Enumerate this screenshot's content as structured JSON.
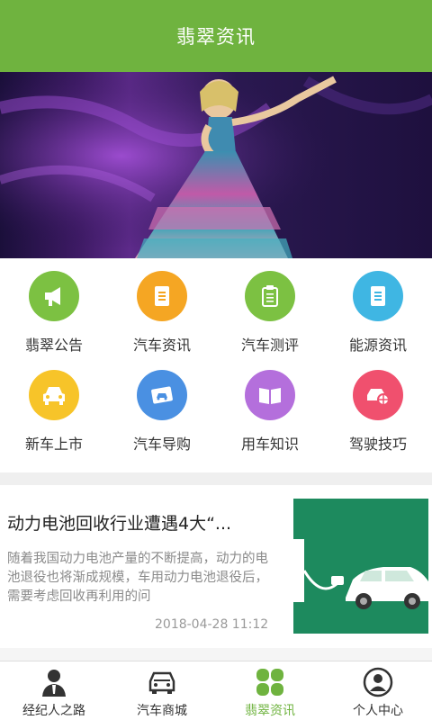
{
  "header": {
    "title": "翡翠资讯"
  },
  "colors": {
    "accent": "#6fb33f"
  },
  "grid": [
    {
      "label": "翡翠公告",
      "icon": "megaphone-icon",
      "color": "#7cc142"
    },
    {
      "label": "汽车资讯",
      "icon": "document-icon",
      "color": "#f5a623"
    },
    {
      "label": "汽车测评",
      "icon": "clipboard-icon",
      "color": "#7cc142"
    },
    {
      "label": "能源资讯",
      "icon": "document-icon",
      "color": "#3fb6e3"
    },
    {
      "label": "新车上市",
      "icon": "car-icon",
      "color": "#f7c429"
    },
    {
      "label": "汽车导购",
      "icon": "car-photo-icon",
      "color": "#4a90e2"
    },
    {
      "label": "用车知识",
      "icon": "book-icon",
      "color": "#b46fdc"
    },
    {
      "label": "驾驶技巧",
      "icon": "car-wheel-icon",
      "color": "#f0506e"
    }
  ],
  "news": [
    {
      "title": "动力电池回收行业遭遇4大“...",
      "summary": "随着我国动力电池产量的不断提高，动力的电池退役也将渐成规模，车用动力电池退役后，需要考虑回收再利用的问",
      "date": "2018-04-28 11:12",
      "thumb": "ev-charging-image"
    }
  ],
  "tabbar": [
    {
      "label": "经纪人之路",
      "icon": "agent-icon",
      "active": false
    },
    {
      "label": "汽车商城",
      "icon": "car-icon",
      "active": false
    },
    {
      "label": "翡翠资讯",
      "icon": "clover-icon",
      "active": true
    },
    {
      "label": "个人中心",
      "icon": "user-icon",
      "active": false
    }
  ]
}
